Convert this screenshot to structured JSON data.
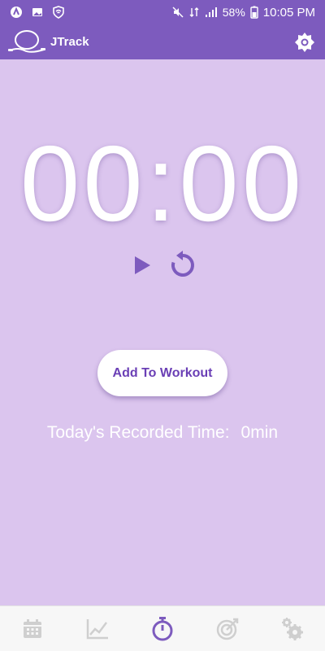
{
  "status_bar": {
    "battery": "58%",
    "time": "10:05 PM"
  },
  "app_bar": {
    "title": "JTrack",
    "logo_icon": "jump-rope-logo",
    "settings_icon": "gear-icon"
  },
  "timer": {
    "display": "00:00"
  },
  "controls": {
    "play_icon": "play-icon",
    "reset_icon": "reset-icon"
  },
  "add_button": {
    "label": "Add To Workout"
  },
  "recorded": {
    "label": "Today's Recorded Time:",
    "value": "0min"
  },
  "bottom_nav": {
    "items": [
      {
        "icon": "calendar-icon",
        "active": false
      },
      {
        "icon": "chart-icon",
        "active": false
      },
      {
        "icon": "stopwatch-icon",
        "active": true
      },
      {
        "icon": "target-icon",
        "active": false
      },
      {
        "icon": "settings-icon",
        "active": false
      }
    ]
  },
  "colors": {
    "primary": "#7d5bbe",
    "background": "#dbc5ee",
    "accent": "#6a3fb5",
    "nav_inactive": "#cfcfcf"
  }
}
